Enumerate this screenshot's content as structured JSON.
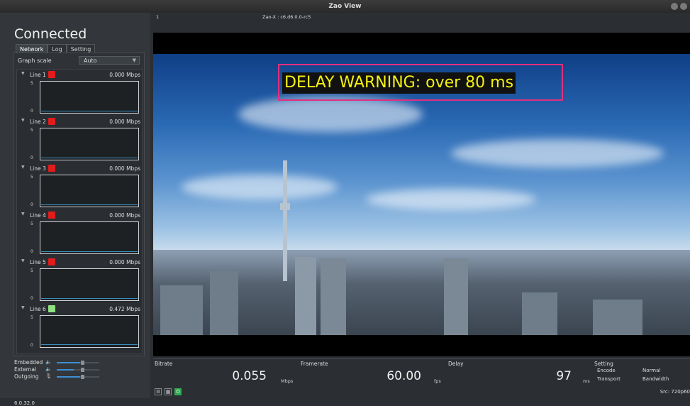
{
  "window": {
    "title": "Zao View"
  },
  "sidebar": {
    "status": "Connected",
    "tabs": [
      {
        "label": "Network",
        "active": true
      },
      {
        "label": "Log",
        "active": false
      },
      {
        "label": "Setting",
        "active": false
      }
    ],
    "graph_scale": {
      "label": "Graph scale",
      "value": "Auto"
    },
    "lines": [
      {
        "name": "Line 1",
        "rate": "0.000 Mbps",
        "color": "#e21b1b",
        "y_max": "5",
        "y_min": "0"
      },
      {
        "name": "Line 2",
        "rate": "0.000 Mbps",
        "color": "#e21b1b",
        "y_max": "5",
        "y_min": "0"
      },
      {
        "name": "Line 3",
        "rate": "0.000 Mbps",
        "color": "#e21b1b",
        "y_max": "5",
        "y_min": "0"
      },
      {
        "name": "Line 4",
        "rate": "0.000 Mbps",
        "color": "#e21b1b",
        "y_max": "5",
        "y_min": "0"
      },
      {
        "name": "Line 5",
        "rate": "0.000 Mbps",
        "color": "#e21b1b",
        "y_max": "5",
        "y_min": "0"
      },
      {
        "name": "Line 6",
        "rate": "0.472 Mbps",
        "color": "#8fe07f",
        "y_max": "5",
        "y_min": "0"
      }
    ],
    "audio": [
      {
        "label": "Embedded",
        "icon": "speaker-icon"
      },
      {
        "label": "External",
        "icon": "speaker-icon"
      },
      {
        "label": "Outgoing",
        "icon": "microphone-icon"
      }
    ],
    "version": "6.0.32.0"
  },
  "main": {
    "index": "1",
    "device": "Zao-X : c6.d6.0.0-rc5",
    "warning": "DELAY WARNING: over 80 ms",
    "stats": {
      "bitrate": {
        "label": "Bitrate",
        "value": "0.055",
        "unit": "Mbps"
      },
      "framerate": {
        "label": "Framerate",
        "value": "60.00",
        "unit": "fps"
      },
      "delay": {
        "label": "Delay",
        "value": "97",
        "unit": "ms"
      }
    },
    "setting": {
      "label": "Setting",
      "encode_label": "Encode",
      "encode_value": "Normal",
      "transport_label": "Transport",
      "transport_value": "Bandwidth"
    },
    "source": "Src: 720p60"
  }
}
